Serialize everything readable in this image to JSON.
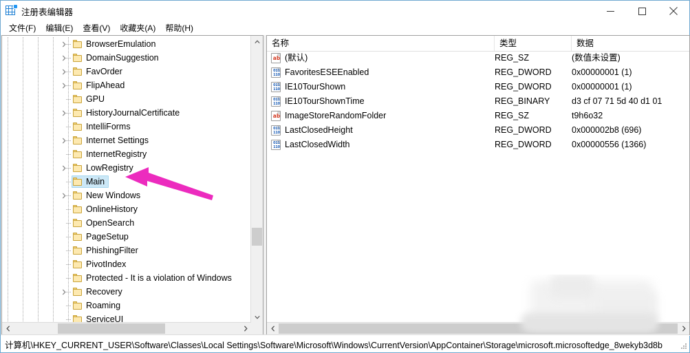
{
  "window": {
    "title": "注册表编辑器",
    "app_icon": "registry-editor-icon",
    "controls": {
      "minimize": "minimize-icon",
      "maximize": "maximize-icon",
      "close": "close-icon"
    }
  },
  "menubar": {
    "items": [
      {
        "label": "文件(F)"
      },
      {
        "label": "编辑(E)"
      },
      {
        "label": "查看(V)"
      },
      {
        "label": "收藏夹(A)"
      },
      {
        "label": "帮助(H)"
      }
    ]
  },
  "tree": {
    "items": [
      {
        "label": "BrowserEmulation",
        "expandable": true,
        "selected": false
      },
      {
        "label": "DomainSuggestion",
        "expandable": true,
        "selected": false
      },
      {
        "label": "FavOrder",
        "expandable": true,
        "selected": false
      },
      {
        "label": "FlipAhead",
        "expandable": true,
        "selected": false
      },
      {
        "label": "GPU",
        "expandable": false,
        "selected": false
      },
      {
        "label": "HistoryJournalCertificate",
        "expandable": true,
        "selected": false
      },
      {
        "label": "IntelliForms",
        "expandable": false,
        "selected": false
      },
      {
        "label": "Internet Settings",
        "expandable": true,
        "selected": false
      },
      {
        "label": "InternetRegistry",
        "expandable": false,
        "selected": false
      },
      {
        "label": "LowRegistry",
        "expandable": true,
        "selected": false
      },
      {
        "label": "Main",
        "expandable": false,
        "selected": true
      },
      {
        "label": "New Windows",
        "expandable": true,
        "selected": false
      },
      {
        "label": "OnlineHistory",
        "expandable": false,
        "selected": false
      },
      {
        "label": "OpenSearch",
        "expandable": false,
        "selected": false
      },
      {
        "label": "PageSetup",
        "expandable": false,
        "selected": false
      },
      {
        "label": "PhishingFilter",
        "expandable": false,
        "selected": false
      },
      {
        "label": "PivotIndex",
        "expandable": false,
        "selected": false
      },
      {
        "label": "Protected - It is a violation of Windows",
        "expandable": false,
        "selected": false
      },
      {
        "label": "Recovery",
        "expandable": true,
        "selected": false
      },
      {
        "label": "Roaming",
        "expandable": false,
        "selected": false
      },
      {
        "label": "ServiceUI",
        "expandable": false,
        "selected": false
      }
    ]
  },
  "values": {
    "columns": [
      {
        "label": "名称"
      },
      {
        "label": "类型"
      },
      {
        "label": "数据"
      }
    ],
    "rows": [
      {
        "icon": "string-value-icon",
        "icon_kind": "ab",
        "name": "(默认)",
        "type": "REG_SZ",
        "data": "(数值未设置)"
      },
      {
        "icon": "dword-value-icon",
        "icon_kind": "bin",
        "name": "FavoritesESEEnabled",
        "type": "REG_DWORD",
        "data": "0x00000001 (1)"
      },
      {
        "icon": "dword-value-icon",
        "icon_kind": "bin",
        "name": "IE10TourShown",
        "type": "REG_DWORD",
        "data": "0x00000001 (1)"
      },
      {
        "icon": "binary-value-icon",
        "icon_kind": "bin",
        "name": "IE10TourShownTime",
        "type": "REG_BINARY",
        "data": "d3 cf 07 71 5d 40 d1 01"
      },
      {
        "icon": "string-value-icon",
        "icon_kind": "ab",
        "name": "ImageStoreRandomFolder",
        "type": "REG_SZ",
        "data": "t9h6o32"
      },
      {
        "icon": "dword-value-icon",
        "icon_kind": "bin",
        "name": "LastClosedHeight",
        "type": "REG_DWORD",
        "data": "0x000002b8 (696)"
      },
      {
        "icon": "dword-value-icon",
        "icon_kind": "bin",
        "name": "LastClosedWidth",
        "type": "REG_DWORD",
        "data": "0x00000556 (1366)"
      }
    ]
  },
  "statusbar": {
    "path": "计算机\\HKEY_CURRENT_USER\\Software\\Classes\\Local Settings\\Software\\Microsoft\\Windows\\CurrentVersion\\AppContainer\\Storage\\microsoft.microsoftedge_8wekyb3d8b"
  },
  "annotation": {
    "arrow_color": "#ec2bbe",
    "points_at": "Main"
  },
  "colors": {
    "selection": "#cce8f7",
    "folder": "#fde9b0",
    "folder_border": "#c9a33a",
    "string_icon": "#d33a22",
    "binary_icon": "#1d5fb8",
    "window_border": "#6fa8d0",
    "scrollbar_thumb": "#cdcdcd"
  }
}
